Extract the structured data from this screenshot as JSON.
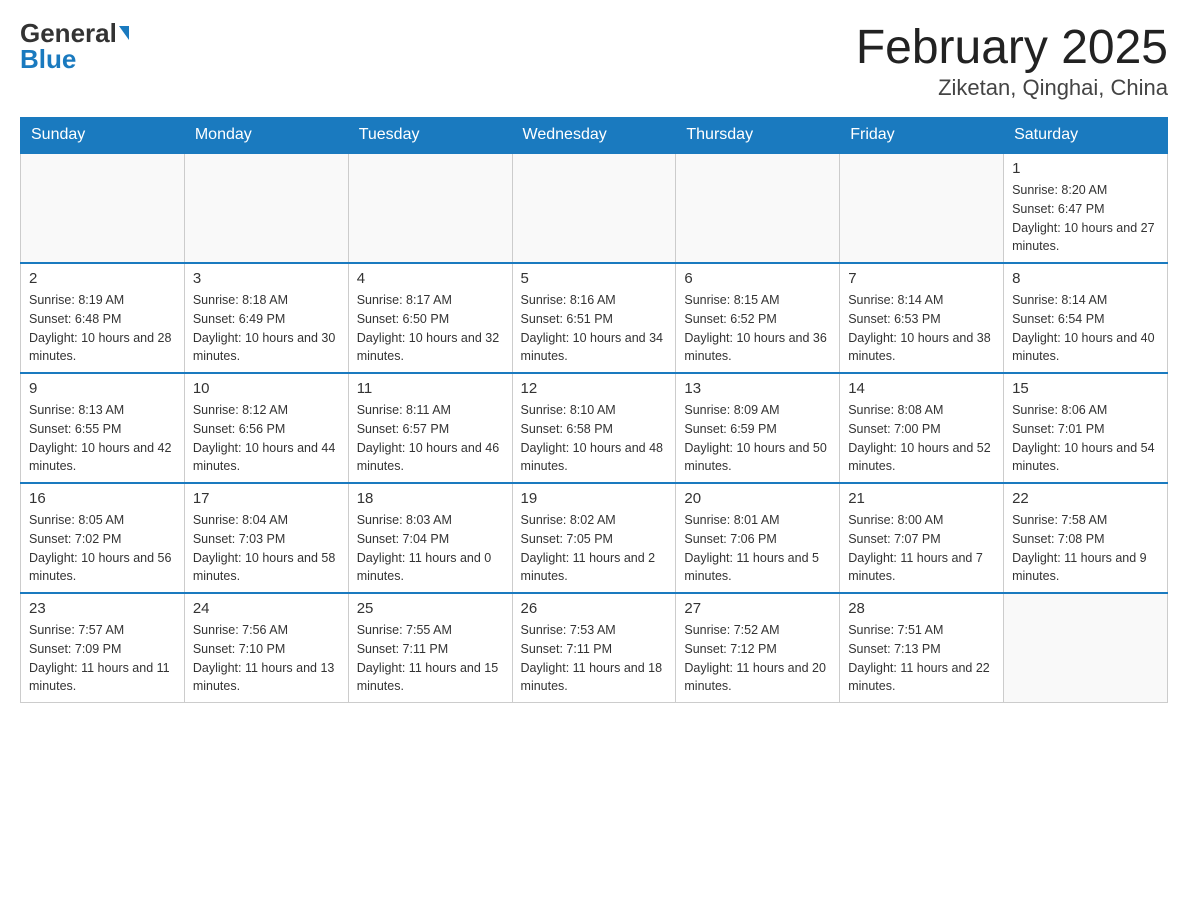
{
  "header": {
    "logo_general": "General",
    "logo_blue": "Blue",
    "title": "February 2025",
    "subtitle": "Ziketan, Qinghai, China"
  },
  "calendar": {
    "days_of_week": [
      "Sunday",
      "Monday",
      "Tuesday",
      "Wednesday",
      "Thursday",
      "Friday",
      "Saturday"
    ],
    "weeks": [
      [
        {
          "day": "",
          "info": ""
        },
        {
          "day": "",
          "info": ""
        },
        {
          "day": "",
          "info": ""
        },
        {
          "day": "",
          "info": ""
        },
        {
          "day": "",
          "info": ""
        },
        {
          "day": "",
          "info": ""
        },
        {
          "day": "1",
          "info": "Sunrise: 8:20 AM\nSunset: 6:47 PM\nDaylight: 10 hours and 27 minutes."
        }
      ],
      [
        {
          "day": "2",
          "info": "Sunrise: 8:19 AM\nSunset: 6:48 PM\nDaylight: 10 hours and 28 minutes."
        },
        {
          "day": "3",
          "info": "Sunrise: 8:18 AM\nSunset: 6:49 PM\nDaylight: 10 hours and 30 minutes."
        },
        {
          "day": "4",
          "info": "Sunrise: 8:17 AM\nSunset: 6:50 PM\nDaylight: 10 hours and 32 minutes."
        },
        {
          "day": "5",
          "info": "Sunrise: 8:16 AM\nSunset: 6:51 PM\nDaylight: 10 hours and 34 minutes."
        },
        {
          "day": "6",
          "info": "Sunrise: 8:15 AM\nSunset: 6:52 PM\nDaylight: 10 hours and 36 minutes."
        },
        {
          "day": "7",
          "info": "Sunrise: 8:14 AM\nSunset: 6:53 PM\nDaylight: 10 hours and 38 minutes."
        },
        {
          "day": "8",
          "info": "Sunrise: 8:14 AM\nSunset: 6:54 PM\nDaylight: 10 hours and 40 minutes."
        }
      ],
      [
        {
          "day": "9",
          "info": "Sunrise: 8:13 AM\nSunset: 6:55 PM\nDaylight: 10 hours and 42 minutes."
        },
        {
          "day": "10",
          "info": "Sunrise: 8:12 AM\nSunset: 6:56 PM\nDaylight: 10 hours and 44 minutes."
        },
        {
          "day": "11",
          "info": "Sunrise: 8:11 AM\nSunset: 6:57 PM\nDaylight: 10 hours and 46 minutes."
        },
        {
          "day": "12",
          "info": "Sunrise: 8:10 AM\nSunset: 6:58 PM\nDaylight: 10 hours and 48 minutes."
        },
        {
          "day": "13",
          "info": "Sunrise: 8:09 AM\nSunset: 6:59 PM\nDaylight: 10 hours and 50 minutes."
        },
        {
          "day": "14",
          "info": "Sunrise: 8:08 AM\nSunset: 7:00 PM\nDaylight: 10 hours and 52 minutes."
        },
        {
          "day": "15",
          "info": "Sunrise: 8:06 AM\nSunset: 7:01 PM\nDaylight: 10 hours and 54 minutes."
        }
      ],
      [
        {
          "day": "16",
          "info": "Sunrise: 8:05 AM\nSunset: 7:02 PM\nDaylight: 10 hours and 56 minutes."
        },
        {
          "day": "17",
          "info": "Sunrise: 8:04 AM\nSunset: 7:03 PM\nDaylight: 10 hours and 58 minutes."
        },
        {
          "day": "18",
          "info": "Sunrise: 8:03 AM\nSunset: 7:04 PM\nDaylight: 11 hours and 0 minutes."
        },
        {
          "day": "19",
          "info": "Sunrise: 8:02 AM\nSunset: 7:05 PM\nDaylight: 11 hours and 2 minutes."
        },
        {
          "day": "20",
          "info": "Sunrise: 8:01 AM\nSunset: 7:06 PM\nDaylight: 11 hours and 5 minutes."
        },
        {
          "day": "21",
          "info": "Sunrise: 8:00 AM\nSunset: 7:07 PM\nDaylight: 11 hours and 7 minutes."
        },
        {
          "day": "22",
          "info": "Sunrise: 7:58 AM\nSunset: 7:08 PM\nDaylight: 11 hours and 9 minutes."
        }
      ],
      [
        {
          "day": "23",
          "info": "Sunrise: 7:57 AM\nSunset: 7:09 PM\nDaylight: 11 hours and 11 minutes."
        },
        {
          "day": "24",
          "info": "Sunrise: 7:56 AM\nSunset: 7:10 PM\nDaylight: 11 hours and 13 minutes."
        },
        {
          "day": "25",
          "info": "Sunrise: 7:55 AM\nSunset: 7:11 PM\nDaylight: 11 hours and 15 minutes."
        },
        {
          "day": "26",
          "info": "Sunrise: 7:53 AM\nSunset: 7:11 PM\nDaylight: 11 hours and 18 minutes."
        },
        {
          "day": "27",
          "info": "Sunrise: 7:52 AM\nSunset: 7:12 PM\nDaylight: 11 hours and 20 minutes."
        },
        {
          "day": "28",
          "info": "Sunrise: 7:51 AM\nSunset: 7:13 PM\nDaylight: 11 hours and 22 minutes."
        },
        {
          "day": "",
          "info": ""
        }
      ]
    ]
  }
}
